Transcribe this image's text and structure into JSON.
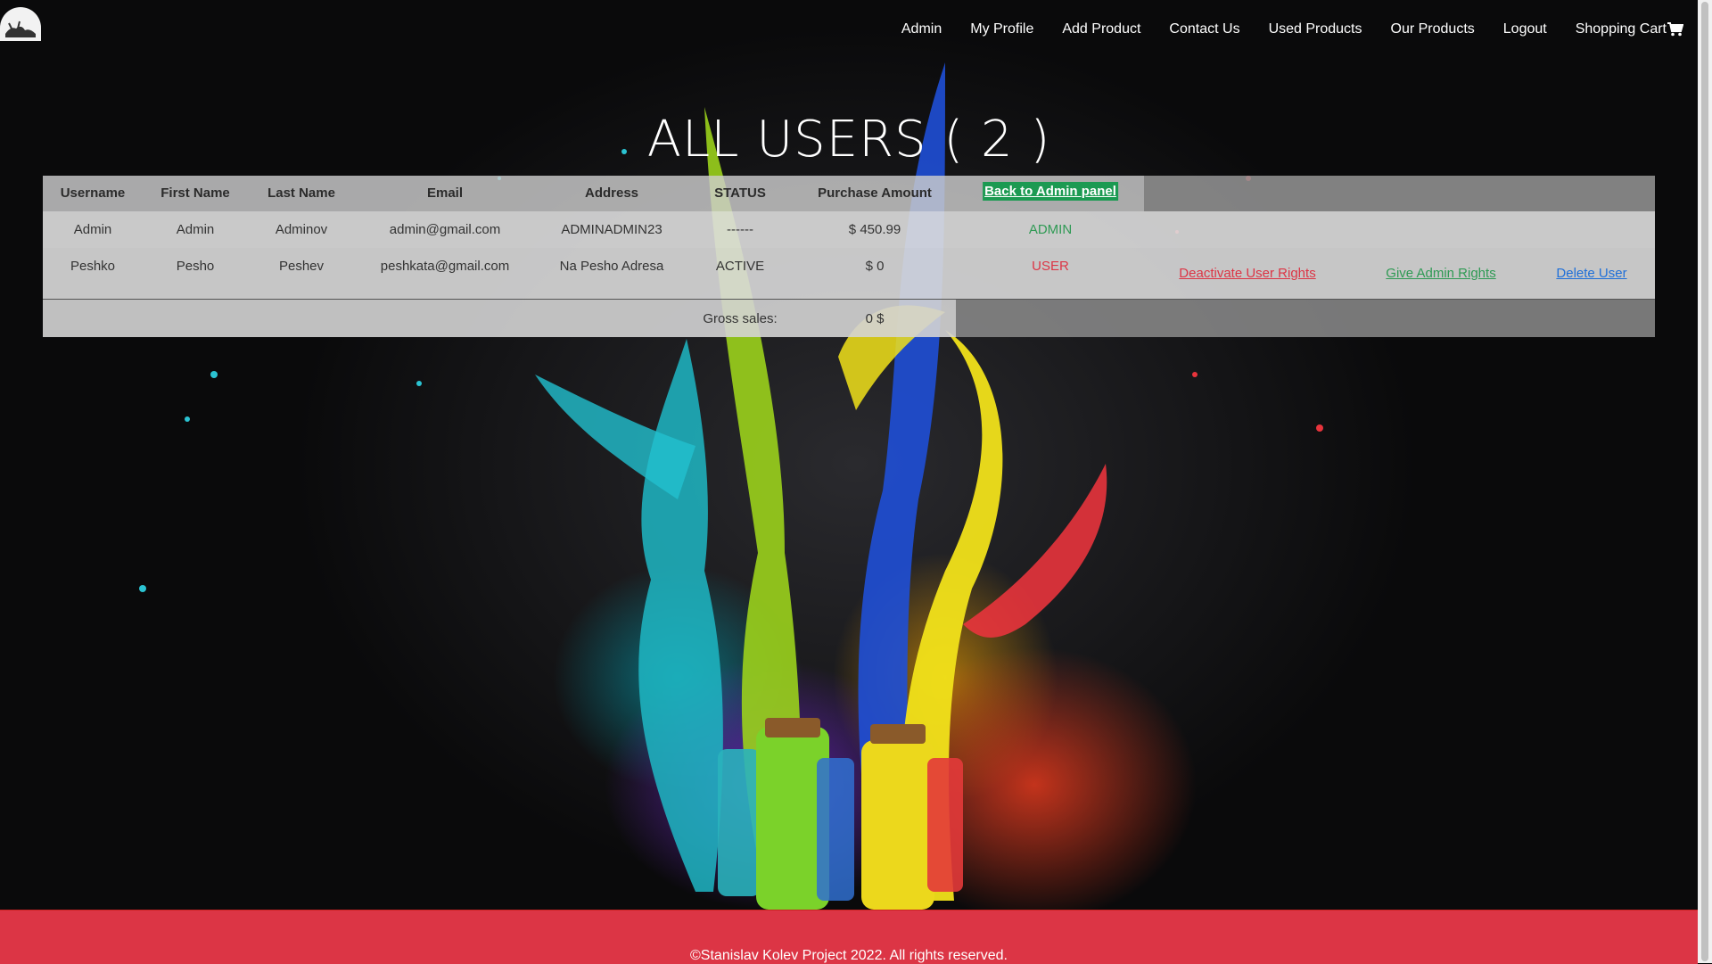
{
  "nav": {
    "items": [
      {
        "label": "Admin"
      },
      {
        "label": "My Profile"
      },
      {
        "label": "Add Product"
      },
      {
        "label": "Contact Us"
      },
      {
        "label": "Used Products"
      },
      {
        "label": "Our Products"
      },
      {
        "label": "Logout"
      }
    ],
    "cart_label": "Shopping Cart",
    "cart_icon": "shopping-cart-icon"
  },
  "logo_icon": "logo-icon",
  "page_title": "ALL USERS ( 2 )",
  "table": {
    "headers": {
      "username": "Username",
      "first_name": "First Name",
      "last_name": "Last Name",
      "email": "Email",
      "address": "Address",
      "status": "STATUS",
      "purchase_amount": "Purchase Amount"
    },
    "back_button": "Back to Admin panel",
    "rows": [
      {
        "username": "Admin",
        "first_name": "Admin",
        "last_name": "Adminov",
        "email": "admin@gmail.com",
        "address": "ADMINADMIN23",
        "status": "------",
        "purchase_amount": "$ 450.99",
        "role": "ADMIN"
      },
      {
        "username": "Peshko",
        "first_name": "Pesho",
        "last_name": "Peshev",
        "email": "peshkata@gmail.com",
        "address": "Na Pesho Adresa",
        "status": "ACTIVE",
        "purchase_amount": "$ 0",
        "role": "USER",
        "actions": {
          "deactivate": "Deactivate User Rights",
          "give_admin": "Give Admin Rights",
          "delete": "Delete User"
        }
      }
    ],
    "gross_sales_label": "Gross sales:",
    "gross_sales_value": "0 $"
  },
  "footer": {
    "text": "©Stanislav Kolev Project 2022. All rights reserved."
  },
  "colors": {
    "footer_bg": "#dc3545",
    "admin_green": "#2f9a54",
    "user_red": "#dc3545",
    "link_blue": "#1e6fd9",
    "button_green": "#1c9a52"
  }
}
